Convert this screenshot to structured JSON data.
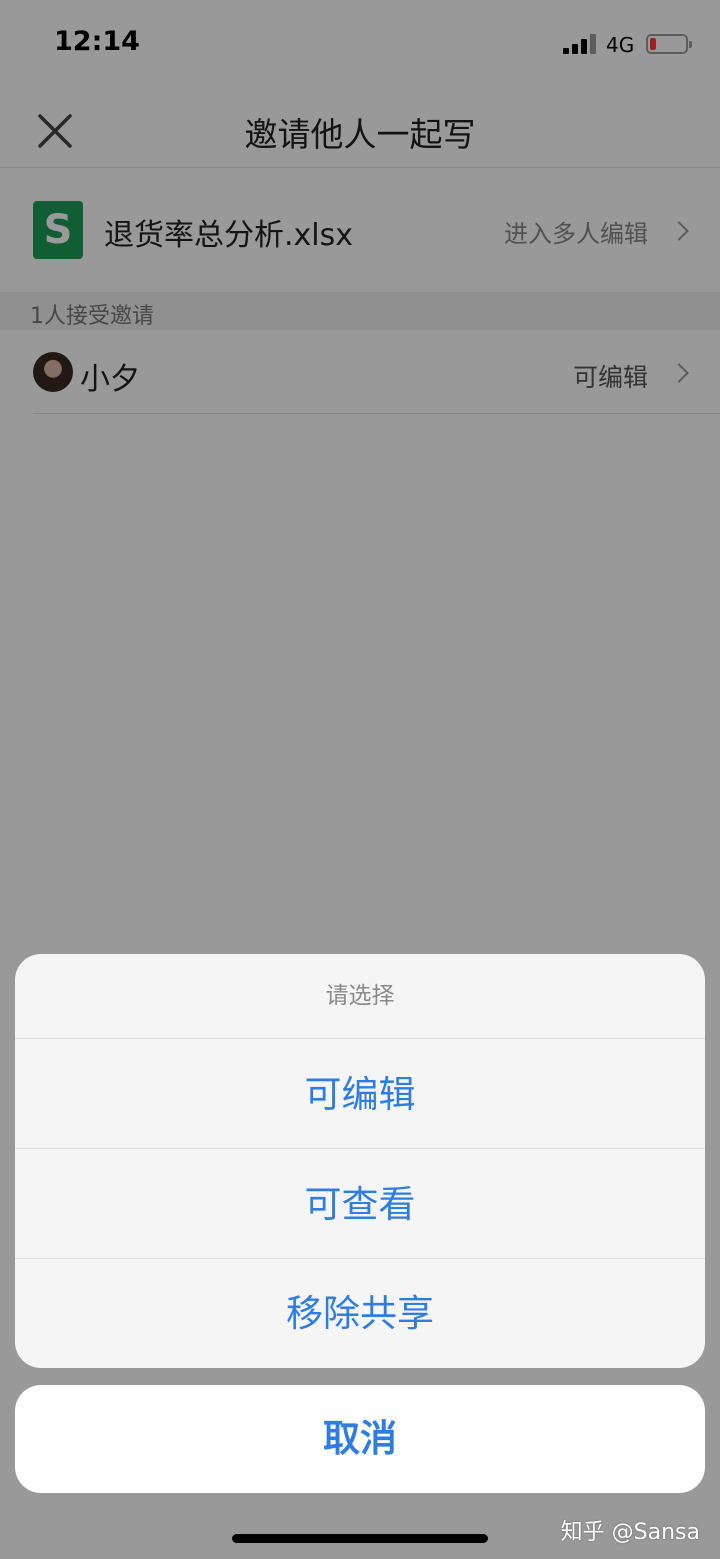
{
  "status_bar": {
    "time": "12:14",
    "network": "4G"
  },
  "nav": {
    "title": "邀请他人一起写"
  },
  "file": {
    "icon_letter": "S",
    "name": "退货率总分析.xlsx",
    "multi_edit_label": "进入多人编辑"
  },
  "members": {
    "section_header": "1人接受邀请",
    "items": [
      {
        "name": "小夕",
        "permission": "可编辑"
      }
    ]
  },
  "action_sheet": {
    "title": "请选择",
    "options": [
      "可编辑",
      "可查看",
      "移除共享"
    ],
    "cancel_label": "取消"
  },
  "watermark": "知乎 @Sansa",
  "colors": {
    "accent": "#2f7de1",
    "file_icon": "#1f9d57",
    "battery_low": "#ff3b30"
  }
}
